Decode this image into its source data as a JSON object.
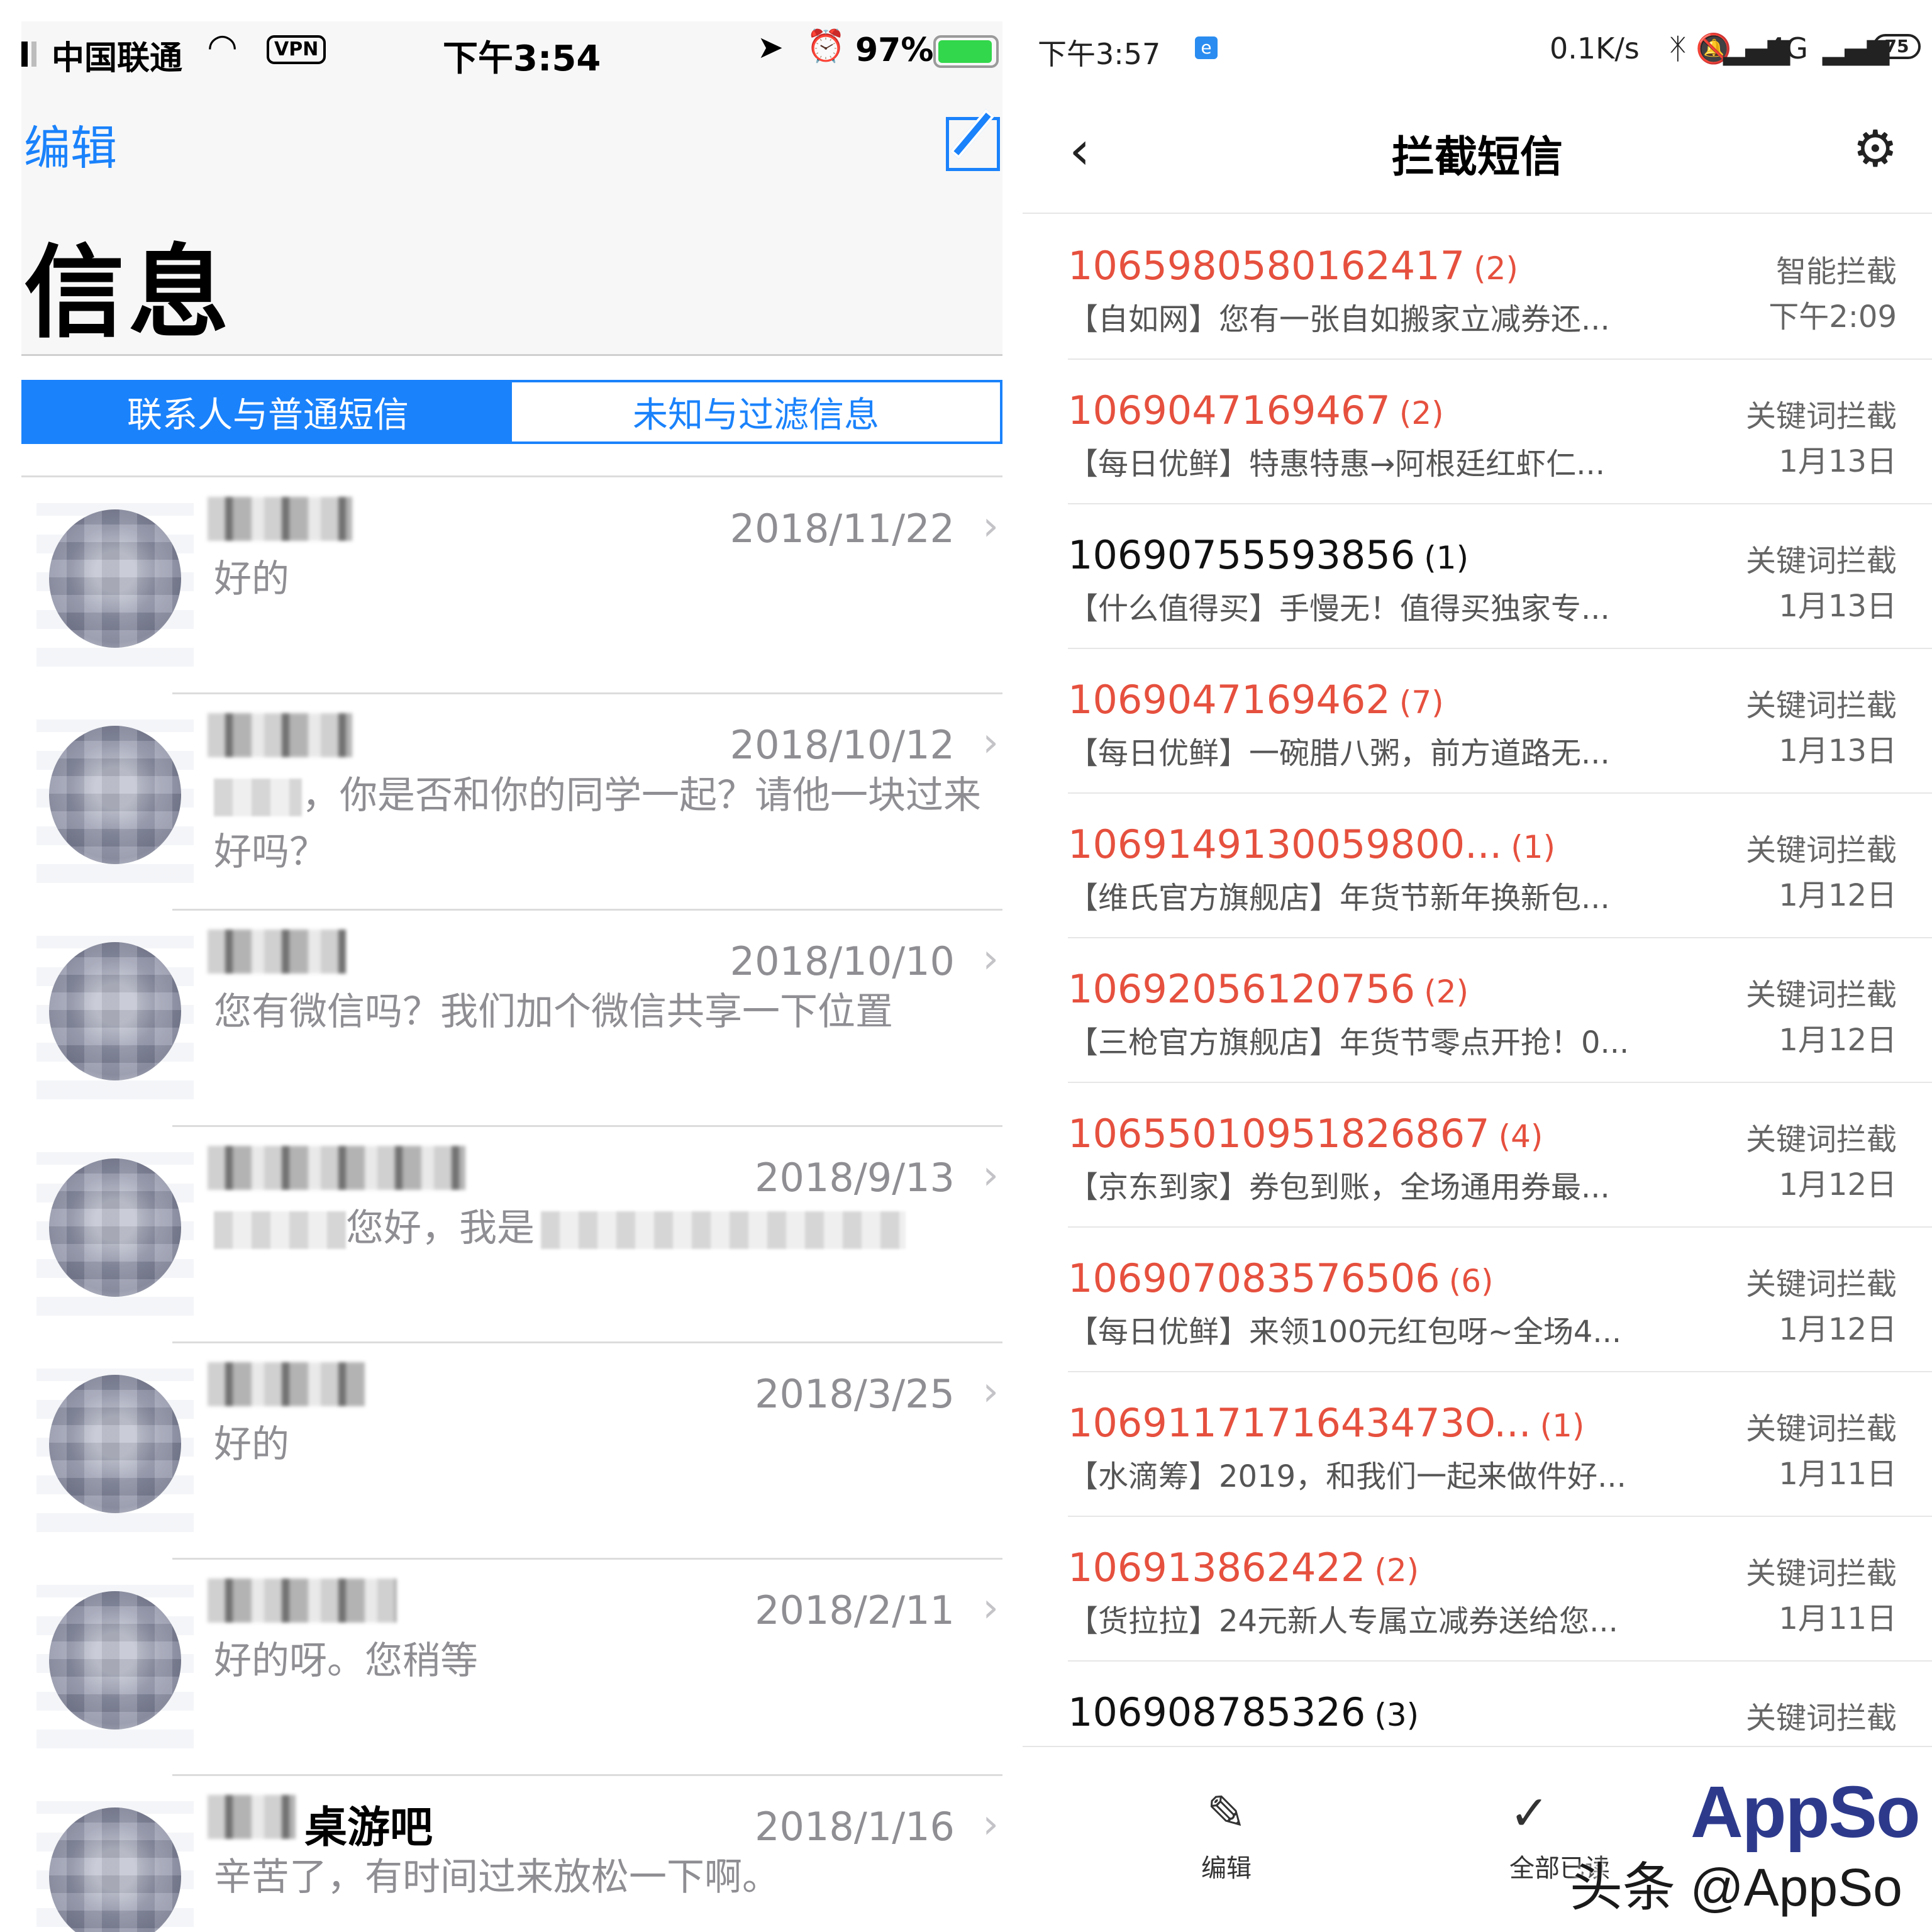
{
  "left": {
    "status": {
      "carrier": "中国联通",
      "vpn": "VPN",
      "time": "下午3:54",
      "battery_pct": "97%",
      "battery_level": 0.97,
      "location_icon": "location-arrow-icon",
      "alarm_icon": "alarm-icon",
      "wifi_icon": "wifi-icon"
    },
    "edit_label": "编辑",
    "compose_icon": "compose-icon",
    "title": "信息",
    "tabs": [
      {
        "label": "联系人与普通短信",
        "active": true
      },
      {
        "label": "未知与过滤信息",
        "active": false
      }
    ],
    "conversations": [
      {
        "date": "2018/11/22",
        "preview": "好的"
      },
      {
        "date": "2018/10/12",
        "preview": "，你是否和你的同学一起？请他一块过来好吗？"
      },
      {
        "date": "2018/10/10",
        "preview": "您有微信吗？我们加个微信共享一下位置"
      },
      {
        "date": "2018/9/13",
        "preview": "您好，我是"
      },
      {
        "date": "2018/3/25",
        "preview": "好的"
      },
      {
        "date": "2018/2/11",
        "preview": "好的呀。您稍等"
      },
      {
        "date": "2018/1/16",
        "name": "桌游吧",
        "preview": "辛苦了，有时间过来放松一下啊。"
      }
    ],
    "accent": "#1a82fb"
  },
  "right": {
    "status": {
      "time": "下午3:57",
      "net_speed": "0.1K/s",
      "network": "4G",
      "battery": "75",
      "bluetooth_icon": "bluetooth-icon",
      "mute_icon": "mute-icon"
    },
    "title": "拦截短信",
    "back_icon": "back-chevron-icon",
    "settings_icon": "gear-icon",
    "items": [
      {
        "number": "1065980580162417",
        "count": "(2)",
        "snippet": "【自如网】您有一张自如搬家立减券还...",
        "kind": "智能拦截",
        "time": "下午2:09",
        "unread": true
      },
      {
        "number": "1069047169467",
        "count": "(2)",
        "snippet": "【每日优鲜】特惠特惠→阿根廷红虾仁...",
        "kind": "关键词拦截",
        "time": "1月13日",
        "unread": true
      },
      {
        "number": "10690755593856",
        "count": "(1)",
        "snippet": "【什么值得买】手慢无！值得买独家专...",
        "kind": "关键词拦截",
        "time": "1月13日",
        "unread": false
      },
      {
        "number": "1069047169462",
        "count": "(7)",
        "snippet": "【每日优鲜】一碗腊八粥，前方道路无...",
        "kind": "关键词拦截",
        "time": "1月13日",
        "unread": true
      },
      {
        "number": "1069149130059800...",
        "count": "(1)",
        "snippet": "【维氏官方旗舰店】年货节新年换新包...",
        "kind": "关键词拦截",
        "time": "1月12日",
        "unread": true
      },
      {
        "number": "10692056120756",
        "count": "(2)",
        "snippet": "【三枪官方旗舰店】年货节零点开抢！0...",
        "kind": "关键词拦截",
        "time": "1月12日",
        "unread": true
      },
      {
        "number": "10655010951826867",
        "count": "(4)",
        "snippet": "【京东到家】券包到账，全场通用券最...",
        "kind": "关键词拦截",
        "time": "1月12日",
        "unread": true
      },
      {
        "number": "106907083576506",
        "count": "(6)",
        "snippet": "【每日优鲜】来领100元红包呀~全场4...",
        "kind": "关键词拦截",
        "time": "1月12日",
        "unread": true
      },
      {
        "number": "1069117171643473O...",
        "count": "(1)",
        "snippet": "【水滴筹】2019，和我们一起来做件好...",
        "kind": "关键词拦截",
        "time": "1月11日",
        "unread": true
      },
      {
        "number": "106913862422",
        "count": "(2)",
        "snippet": "【货拉拉】24元新人专属立减券送给您...",
        "kind": "关键词拦截",
        "time": "1月11日",
        "unread": true
      },
      {
        "number": "106908785326",
        "count": "(3)",
        "snippet": "",
        "kind": "关键词拦截",
        "time": "",
        "unread": false
      }
    ],
    "bottom": {
      "edit_label": "编辑",
      "edit_icon": "edit-icon",
      "all_read_label": "全部已读",
      "check_icon": "check-icon"
    },
    "logo_text": "AppSo",
    "watermark": "头条 @AppSo",
    "unread_color": "#e6503e"
  }
}
